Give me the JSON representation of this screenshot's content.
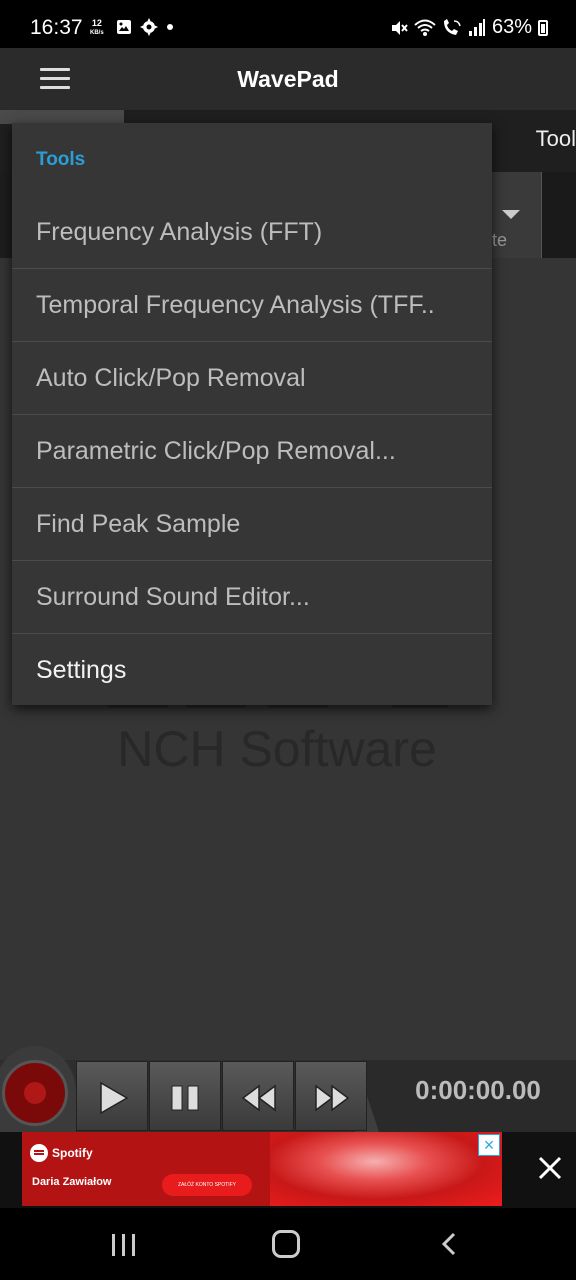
{
  "status_bar": {
    "time": "16:37",
    "net_speed": "12",
    "net_unit": "KB/s",
    "battery": "63%",
    "icons": [
      "gallery-icon",
      "settings-icon",
      "dot-icon",
      "mute-icon",
      "wifi-icon",
      "wifi-call-icon",
      "signal-icon",
      "battery-icon"
    ]
  },
  "app_bar": {
    "title": "WavePad"
  },
  "background": {
    "tab_partial": "Tool",
    "toolbar_partial": "te",
    "logo_text": "NCH Software"
  },
  "tools_menu": {
    "header": "Tools",
    "items": [
      {
        "label": "Frequency Analysis (FFT)"
      },
      {
        "label": "Temporal Frequency Analysis (TFF.."
      },
      {
        "label": "Auto Click/Pop Removal"
      },
      {
        "label": "Parametric Click/Pop Removal..."
      },
      {
        "label": "Find Peak Sample"
      },
      {
        "label": "Surround Sound Editor..."
      },
      {
        "label": "Settings"
      }
    ]
  },
  "transport": {
    "time": "0:00:00.00",
    "buttons": [
      "record-button",
      "play-button",
      "pause-button",
      "rewind-button",
      "fast-forward-button"
    ]
  },
  "ad": {
    "brand": "Spotify",
    "artist": "Daria Zawiałow",
    "cta": "ZAŁÓŻ KONTO SPOTIFY"
  },
  "colors": {
    "accent": "#2a9fd6",
    "menu_bg": "#363636",
    "app_bar_bg": "#2b2b2b",
    "ad_red": "#e81c1c"
  }
}
